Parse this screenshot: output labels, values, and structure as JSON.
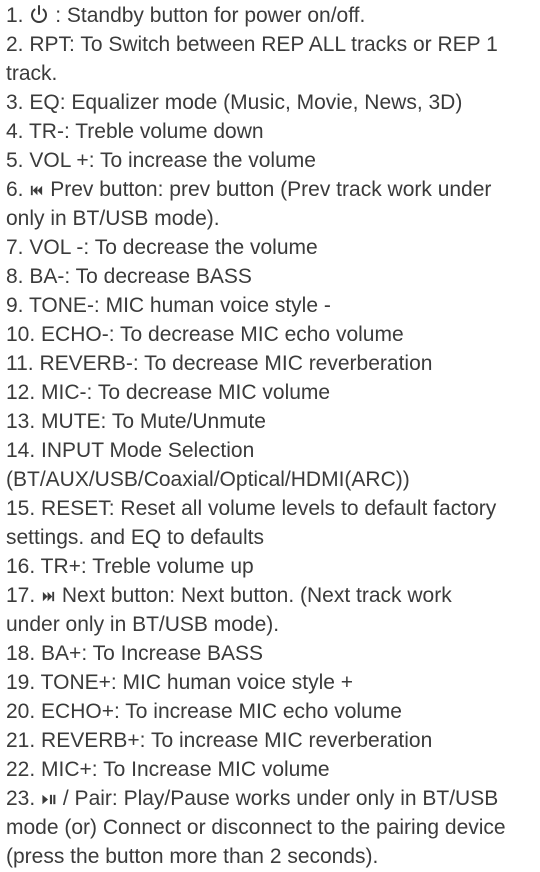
{
  "document": {
    "text_color": "#3b3b3b",
    "items": [
      {
        "number": "1.",
        "icon": "power-icon",
        "lines": [
          ": Standby button for power on/off."
        ]
      },
      {
        "number": "2.",
        "lines": [
          "RPT: To Switch between REP ALL tracks or REP 1",
          "track."
        ]
      },
      {
        "number": "3.",
        "lines": [
          "EQ: Equalizer mode (Music, Movie, News, 3D)"
        ]
      },
      {
        "number": "4.",
        "lines": [
          "TR-: Treble volume down"
        ]
      },
      {
        "number": "5.",
        "lines": [
          "VOL +: To increase the volume"
        ]
      },
      {
        "number": "6.",
        "icon": "previous-track-icon",
        "lines": [
          "Prev button: prev button (Prev track work under",
          "only in BT/USB mode)."
        ]
      },
      {
        "number": "7.",
        "lines": [
          "VOL -: To decrease the volume"
        ]
      },
      {
        "number": "8.",
        "lines": [
          "BA-: To decrease BASS"
        ]
      },
      {
        "number": "9.",
        "lines": [
          "TONE-: MIC human voice style -"
        ]
      },
      {
        "number": "10.",
        "lines": [
          "ECHO-: To decrease MIC echo volume"
        ]
      },
      {
        "number": "11.",
        "lines": [
          "REVERB-: To decrease MIC reverberation"
        ]
      },
      {
        "number": "12.",
        "lines": [
          "MIC-: To decrease MIC volume"
        ]
      },
      {
        "number": "13.",
        "lines": [
          "MUTE: To Mute/Unmute"
        ]
      },
      {
        "number": "14.",
        "lines": [
          "INPUT Mode Selection",
          "(BT/AUX/USB/Coaxial/Optical/HDMI(ARC))"
        ]
      },
      {
        "number": "15.",
        "lines": [
          "RESET: Reset all volume levels to default factory",
          "settings. and EQ to defaults"
        ]
      },
      {
        "number": "16.",
        "lines": [
          "TR+: Treble volume up"
        ]
      },
      {
        "number": "17.",
        "icon": "next-track-icon",
        "lines": [
          "Next button: Next button. (Next track work",
          "under only in BT/USB mode)."
        ]
      },
      {
        "number": "18.",
        "lines": [
          "BA+: To Increase BASS"
        ]
      },
      {
        "number": "19.",
        "lines": [
          "TONE+: MIC human voice style +"
        ]
      },
      {
        "number": "20.",
        "lines": [
          "ECHO+: To increase MIC echo volume"
        ]
      },
      {
        "number": "21.",
        "lines": [
          "REVERB+: To increase MIC reverberation"
        ]
      },
      {
        "number": "22.",
        "lines": [
          "MIC+: To Increase MIC volume"
        ]
      },
      {
        "number": "23.",
        "icon": "play-pause-icon",
        "lines": [
          "/ Pair: Play/Pause works under only in BT/USB",
          "mode (or) Connect or disconnect to the pairing device",
          "(press the button more than 2 seconds)."
        ]
      }
    ]
  }
}
